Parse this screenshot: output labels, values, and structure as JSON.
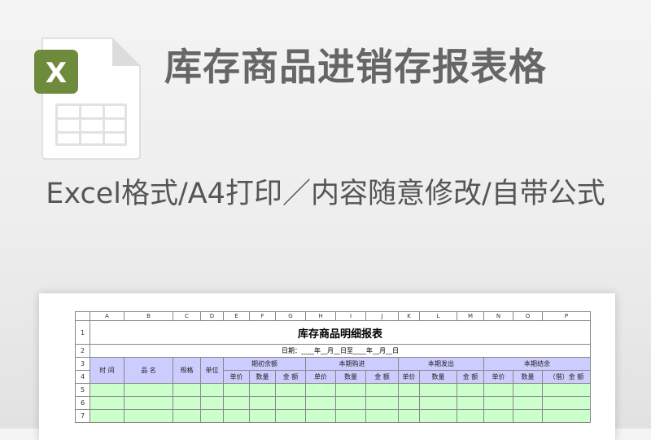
{
  "title": "库存商品进销存报表格",
  "subtitle": "Excel格式/A4打印／内容随意修改/自带公式",
  "icon": {
    "badge": "X",
    "name": "excel-file-icon",
    "badge_color": "#6e8b3d"
  },
  "sheet": {
    "columns": [
      "A",
      "B",
      "C",
      "D",
      "E",
      "F",
      "G",
      "H",
      "I",
      "J",
      "K",
      "L",
      "M",
      "N",
      "O",
      "P"
    ],
    "row_numbers": [
      "1",
      "2",
      "3",
      "4",
      "5",
      "6",
      "7"
    ],
    "title": "库存商品明细报表",
    "date_line": "日期：____年__月__日至____年__月__日",
    "headers": {
      "time": "时  间",
      "name": "品  名",
      "spec": "规格",
      "unit": "单位",
      "group_opening": "期初余额",
      "group_purchase": "本期购进",
      "group_issue": "本期发出",
      "group_closing": "本期结余",
      "unit_price": "单价",
      "quantity": "数量",
      "amount": "金  额",
      "amount_closing": "（借）金  额"
    },
    "colors": {
      "header_bg": "#ccccff",
      "data_bg": "#ccffcc"
    }
  }
}
